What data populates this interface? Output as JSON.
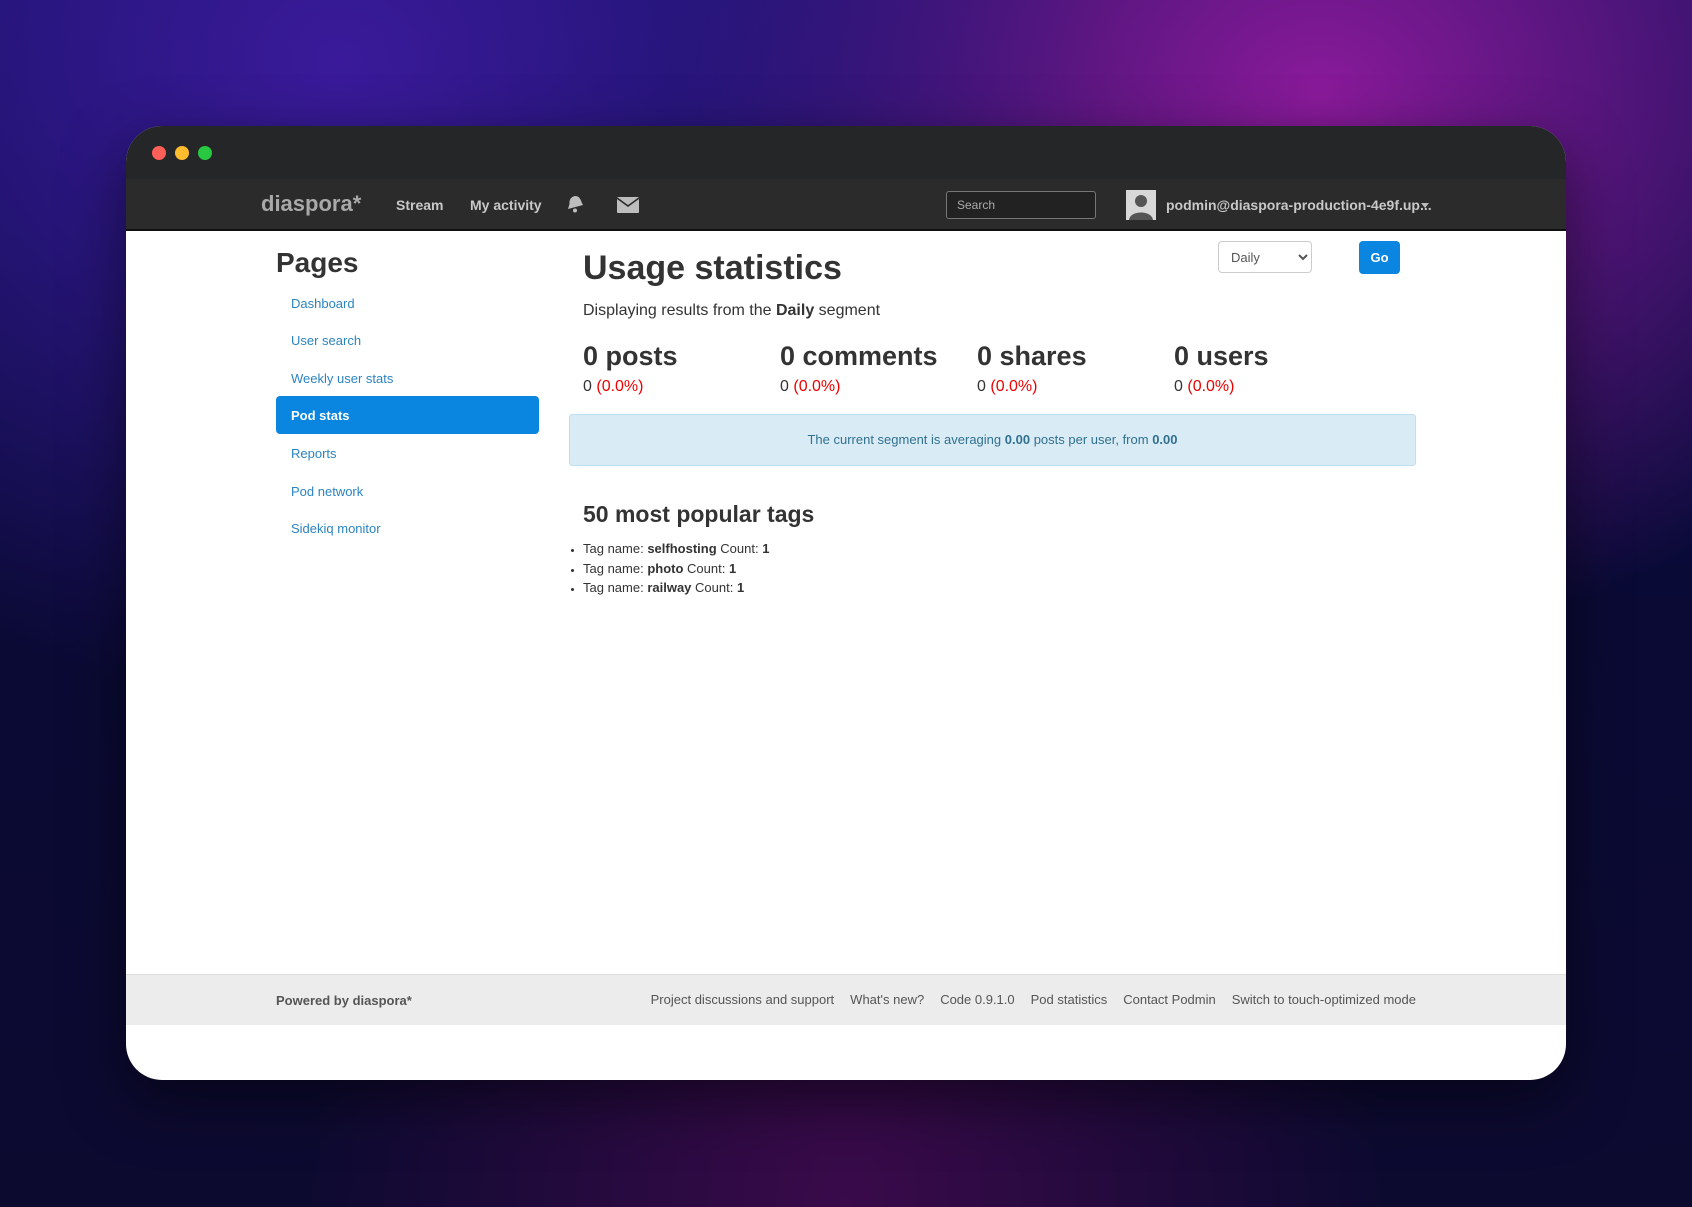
{
  "navbar": {
    "brand": "diaspora*",
    "stream": "Stream",
    "my_activity": "My activity",
    "search_placeholder": "Search",
    "user": "podmin@diaspora-production-4e9f.up..."
  },
  "sidebar": {
    "title": "Pages",
    "items": [
      {
        "label": "Dashboard"
      },
      {
        "label": "User search"
      },
      {
        "label": "Weekly user stats"
      },
      {
        "label": "Pod stats"
      },
      {
        "label": "Reports"
      },
      {
        "label": "Pod network"
      },
      {
        "label": "Sidekiq monitor"
      }
    ],
    "active_index": 3
  },
  "main": {
    "title": "Usage statistics",
    "segment_select": "Daily",
    "go_label": "Go",
    "subtitle_prefix": "Displaying results from the",
    "subtitle_segment": "Daily",
    "subtitle_suffix": "segment",
    "stats": [
      {
        "big": "0 posts",
        "count": "0",
        "pct": "(0.0%)"
      },
      {
        "big": "0 comments",
        "count": "0",
        "pct": "(0.0%)"
      },
      {
        "big": "0 shares",
        "count": "0",
        "pct": "(0.0%)"
      },
      {
        "big": "0 users",
        "count": "0",
        "pct": "(0.0%)"
      }
    ],
    "alert": {
      "prefix": "The current segment is averaging",
      "avg": "0.00",
      "middle": "posts per user, from",
      "from": "0.00"
    },
    "tags_title": "50 most popular tags",
    "tag_name_label": "Tag name:",
    "count_label": "Count:",
    "tags": [
      {
        "name": "selfhosting",
        "count": "1"
      },
      {
        "name": "photo",
        "count": "1"
      },
      {
        "name": "railway",
        "count": "1"
      }
    ]
  },
  "footer": {
    "powered": "Powered by diaspora*",
    "links": [
      "Project discussions and support",
      "What's new?",
      "Code 0.9.1.0",
      "Pod statistics",
      "Contact Podmin",
      "Switch to touch-optimized mode"
    ]
  },
  "colors": {
    "accent": "#0a85e0",
    "link": "#2b84c0",
    "negative": "#e00000",
    "alert_bg": "#d9ecf6"
  }
}
